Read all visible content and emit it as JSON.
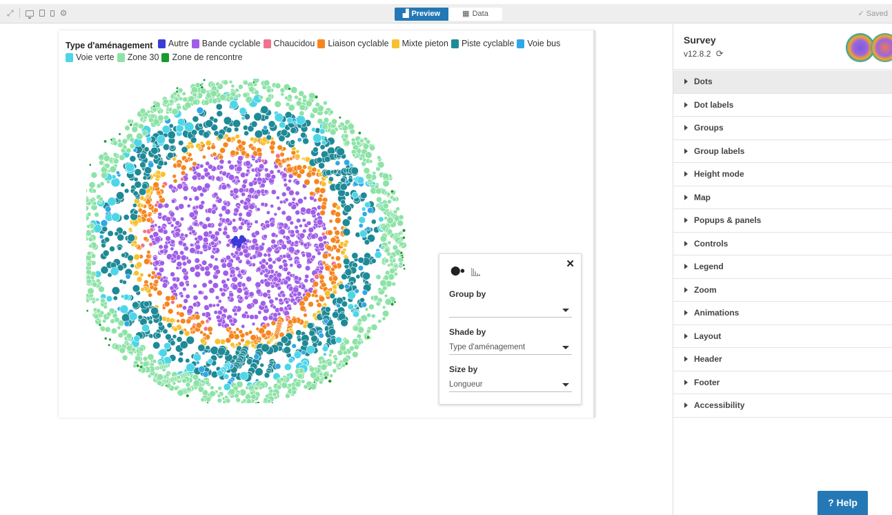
{
  "toolbar": {
    "preview_label": "Preview",
    "data_label": "Data",
    "saved_label": "✓ Saved"
  },
  "legend": {
    "title": "Type d'aménagement",
    "items": [
      {
        "label": "Autre",
        "color": "#3d3bd6"
      },
      {
        "label": "Bande cyclable",
        "color": "#a05ee8"
      },
      {
        "label": "Chaucidou",
        "color": "#f2728d"
      },
      {
        "label": "Liaison cyclable",
        "color": "#f5861f"
      },
      {
        "label": "Mixte pieton",
        "color": "#f7c12f"
      },
      {
        "label": "Piste cyclable",
        "color": "#1e8a97"
      },
      {
        "label": "Voie bus",
        "color": "#2fa7e8"
      },
      {
        "label": "Voie verte",
        "color": "#4dd6e8"
      },
      {
        "label": "Zone 30",
        "color": "#8de3a7"
      },
      {
        "label": "Zone de rencontre",
        "color": "#1a9a2e"
      }
    ]
  },
  "controls": {
    "group_by_label": "Group by",
    "group_by_value": "",
    "shade_by_label": "Shade by",
    "shade_by_value": "Type d'aménagement",
    "size_by_label": "Size by",
    "size_by_value": "Longueur"
  },
  "sidebar": {
    "title": "Survey",
    "version": "v12.8.2",
    "items": [
      {
        "label": "Dots"
      },
      {
        "label": "Dot labels"
      },
      {
        "label": "Groups"
      },
      {
        "label": "Group labels"
      },
      {
        "label": "Height mode"
      },
      {
        "label": "Map"
      },
      {
        "label": "Popups & panels"
      },
      {
        "label": "Controls"
      },
      {
        "label": "Legend"
      },
      {
        "label": "Zoom"
      },
      {
        "label": "Animations"
      },
      {
        "label": "Layout"
      },
      {
        "label": "Header"
      },
      {
        "label": "Footer"
      },
      {
        "label": "Accessibility"
      }
    ]
  },
  "help_label": "? Help"
}
